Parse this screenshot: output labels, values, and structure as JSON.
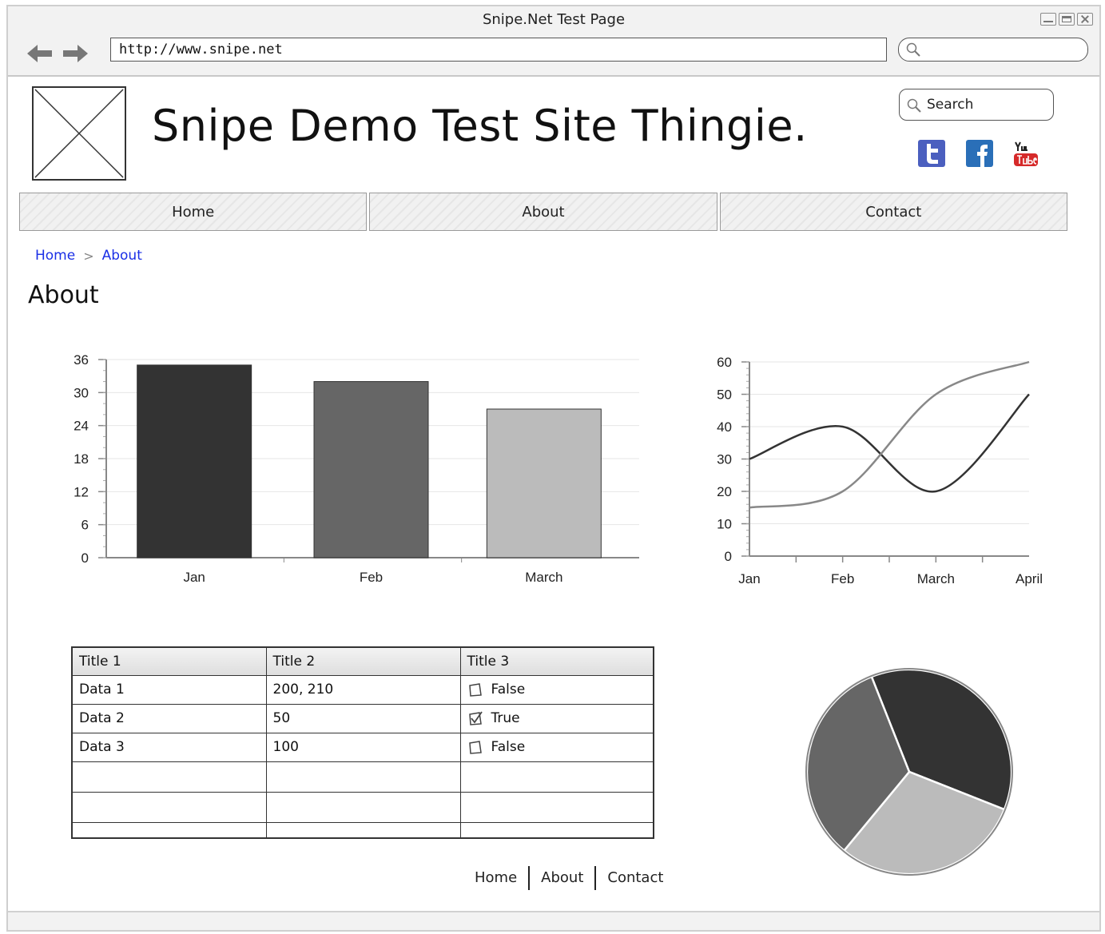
{
  "window": {
    "title": "Snipe.Net Test Page"
  },
  "browser": {
    "url": "http://www.snipe.net",
    "search_value": ""
  },
  "site": {
    "title": "Snipe Demo Test Site Thingie.",
    "search_placeholder": "Search",
    "social": [
      "twitter-icon",
      "facebook-icon",
      "youtube-icon"
    ]
  },
  "nav": {
    "items": [
      "Home",
      "About",
      "Contact"
    ]
  },
  "breadcrumb": {
    "items": [
      "Home",
      "About"
    ]
  },
  "page": {
    "heading": "About"
  },
  "chart_data": [
    {
      "type": "bar",
      "categories": [
        "Jan",
        "Feb",
        "March"
      ],
      "values": [
        35,
        32,
        27
      ],
      "colors": [
        "#333333",
        "#666666",
        "#bbbbbb"
      ],
      "ylim": [
        0,
        36
      ],
      "yticks": [
        0,
        6,
        12,
        18,
        24,
        30,
        36
      ],
      "grid": true
    },
    {
      "type": "line",
      "x": [
        "Jan",
        "Feb",
        "March",
        "April"
      ],
      "series": [
        {
          "values": [
            30,
            40,
            20,
            50
          ],
          "color": "#333333"
        },
        {
          "values": [
            15,
            20,
            50,
            60
          ],
          "color": "#888888"
        }
      ],
      "ylim": [
        0,
        60
      ],
      "yticks": [
        0,
        10,
        20,
        30,
        40,
        50,
        60
      ],
      "grid": true
    },
    {
      "type": "pie",
      "values": [
        37,
        30,
        33
      ],
      "colors": [
        "#333333",
        "#bbbbbb",
        "#666666"
      ]
    }
  ],
  "table": {
    "headers": [
      "Title 1",
      "Title 2",
      "Title 3"
    ],
    "rows": [
      {
        "c1": "Data 1",
        "c2": "200, 210",
        "c3": "False",
        "checked": false
      },
      {
        "c1": "Data 2",
        "c2": "50",
        "c3": "True",
        "checked": true
      },
      {
        "c1": "Data 3",
        "c2": "100",
        "c3": "False",
        "checked": false
      }
    ]
  },
  "footer": {
    "links": [
      "Home",
      "About",
      "Contact"
    ]
  }
}
